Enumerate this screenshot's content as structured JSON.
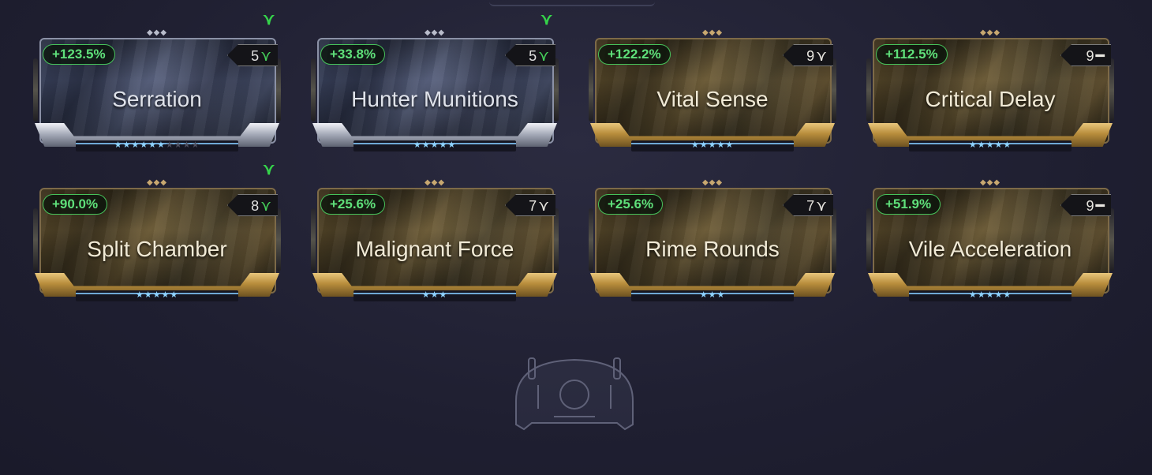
{
  "mods": [
    {
      "name": "Serration",
      "bonus": "+123.5%",
      "drain": "5",
      "polarity": "madurai-icon",
      "rarity": "silver",
      "stars_filled": 6,
      "stars_total": 10,
      "polarity_match": true
    },
    {
      "name": "Hunter Munitions",
      "bonus": "+33.8%",
      "drain": "5",
      "polarity": "madurai-icon",
      "rarity": "silver",
      "stars_filled": 5,
      "stars_total": 5,
      "polarity_match": true
    },
    {
      "name": "Vital Sense",
      "bonus": "+122.2%",
      "drain": "9",
      "polarity": "madurai-icon",
      "rarity": "gold",
      "stars_filled": 5,
      "stars_total": 5,
      "polarity_match": false
    },
    {
      "name": "Critical Delay",
      "bonus": "+112.5%",
      "drain": "9",
      "polarity": "naramon-icon",
      "rarity": "gold",
      "stars_filled": 5,
      "stars_total": 5,
      "polarity_match": false
    },
    {
      "name": "Split Chamber",
      "bonus": "+90.0%",
      "drain": "8",
      "polarity": "madurai-icon",
      "rarity": "gold",
      "stars_filled": 5,
      "stars_total": 5,
      "polarity_match": true
    },
    {
      "name": "Malignant Force",
      "bonus": "+25.6%",
      "drain": "7",
      "polarity": "madurai-icon",
      "rarity": "gold",
      "stars_filled": 3,
      "stars_total": 3,
      "polarity_match": false
    },
    {
      "name": "Rime Rounds",
      "bonus": "+25.6%",
      "drain": "7",
      "polarity": "madurai-icon",
      "rarity": "gold",
      "stars_filled": 3,
      "stars_total": 3,
      "polarity_match": false
    },
    {
      "name": "Vile Acceleration",
      "bonus": "+51.9%",
      "drain": "9",
      "polarity": "naramon-icon",
      "rarity": "gold",
      "stars_filled": 5,
      "stars_total": 5,
      "polarity_match": false
    }
  ],
  "empty_slot": {
    "icon": "exilus-slot-icon"
  },
  "colors": {
    "bonus": "#5fe07a",
    "polarity_match": "#35d34a",
    "gold_frame": "#c49a46",
    "silver_frame": "#b9bccb",
    "rank_line": "#6fa9d6"
  }
}
